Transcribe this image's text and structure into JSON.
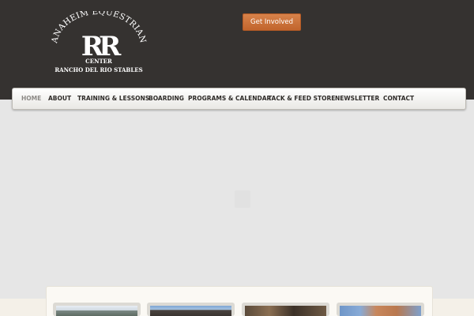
{
  "header": {
    "logo": {
      "arc_text": "ANAHEIM EQUESTRIAN",
      "monogram": "RR",
      "line1": "CENTER",
      "line2": "RANCHO DEL RIO STABLES"
    },
    "cta_label": "Get Involved"
  },
  "nav": {
    "items": [
      {
        "label": "HOME",
        "active": true
      },
      {
        "label": "ABOUT"
      },
      {
        "label": "TRAINING & LESSONS"
      },
      {
        "label": "BOARDING"
      },
      {
        "label": "PROGRAMS & CALENDAR"
      },
      {
        "label": "TACK & FEED STORE"
      },
      {
        "label": "NEWSLETTER"
      },
      {
        "label": "CONTACT"
      }
    ]
  },
  "colors": {
    "header_bg": "#353230",
    "accent_button": "#c96f37",
    "page_bg": "#e6e6e6"
  },
  "thumbnails": [
    {
      "name": "photo-1"
    },
    {
      "name": "photo-2"
    },
    {
      "name": "photo-3"
    },
    {
      "name": "photo-4"
    }
  ]
}
